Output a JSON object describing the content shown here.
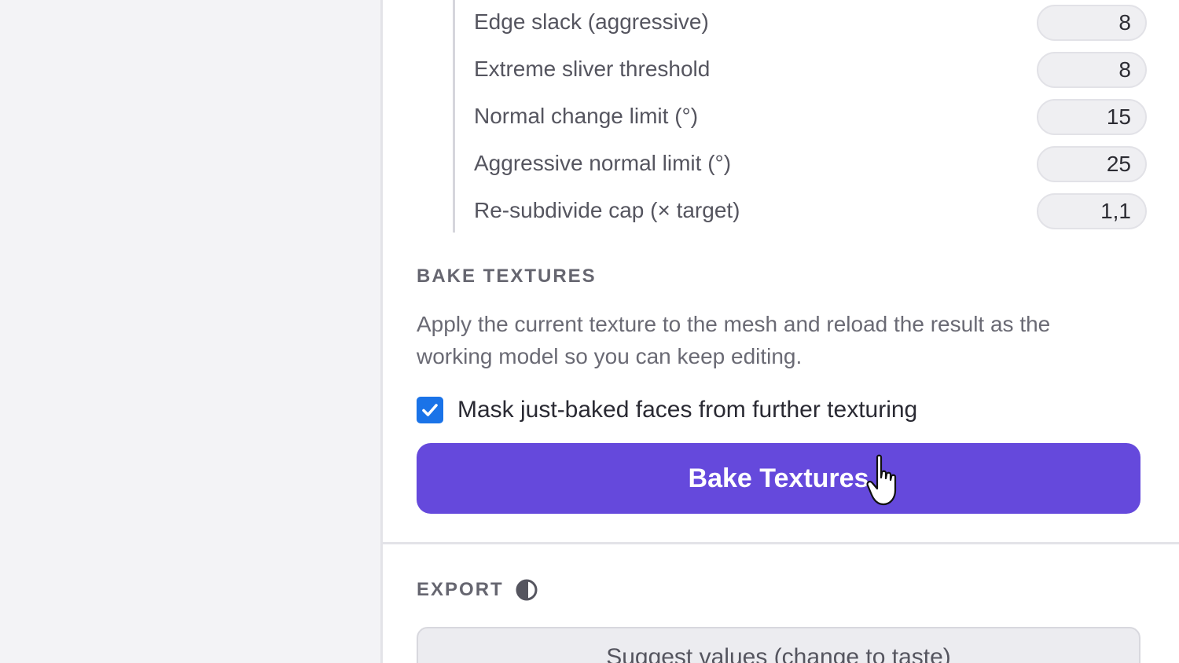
{
  "parameters": [
    {
      "label": "Edge slack (aggressive)",
      "value": "8"
    },
    {
      "label": "Extreme sliver threshold",
      "value": "8"
    },
    {
      "label": "Normal change limit (°)",
      "value": "15"
    },
    {
      "label": "Aggressive normal limit (°)",
      "value": "25"
    },
    {
      "label": "Re-subdivide cap (× target)",
      "value": "1,1"
    }
  ],
  "bake": {
    "title": "BAKE TEXTURES",
    "description": "Apply the current texture to the mesh and reload the result as the working model so you can keep editing.",
    "mask_label": "Mask just-baked faces from further texturing",
    "mask_checked": true,
    "button_label": "Bake Textures"
  },
  "export": {
    "title": "EXPORT",
    "icon": "contrast-toggle-icon",
    "suggest_label": "Suggest values (change to taste)"
  },
  "colors": {
    "accent": "#6549dc",
    "checkbox": "#1a73e8"
  }
}
